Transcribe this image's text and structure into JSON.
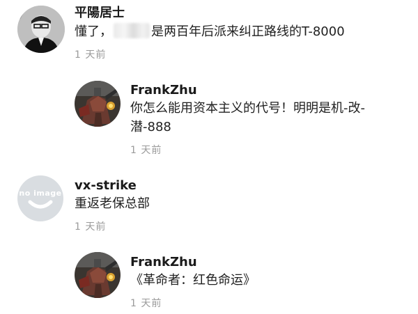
{
  "comments": [
    {
      "author": "平陽居士",
      "text_before": "懂了，",
      "text_after": "是两百年后派来纠正路线的T-8000",
      "time": "1 天前",
      "avatar_icon": "portrait-photo"
    },
    {
      "author": "FrankZhu",
      "text_line1": "你怎么能用资本主义的代号！明明是机-改-",
      "text_line2": "潜-888",
      "time": "1 天前",
      "avatar_icon": "mecha-art"
    },
    {
      "author": "vx-strike",
      "text": "重返老保总部",
      "time": "1 天前",
      "avatar_label": "no image",
      "avatar_icon": "no-image-placeholder"
    },
    {
      "author": "FrankZhu",
      "text": "《革命者：红色命运》",
      "time": "1 天前",
      "avatar_icon": "mecha-art"
    }
  ]
}
